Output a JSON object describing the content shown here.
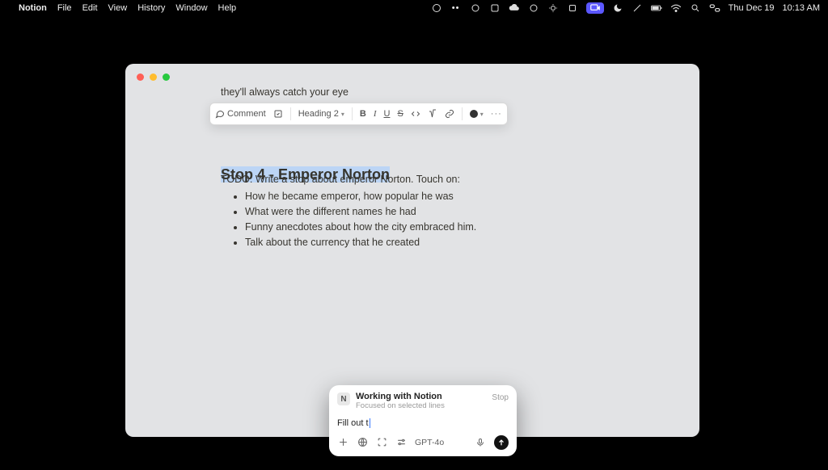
{
  "menubar": {
    "app_name": "Notion",
    "items": [
      "File",
      "Edit",
      "View",
      "History",
      "Window",
      "Help"
    ],
    "date": "Thu Dec 19",
    "time": "10:13 AM"
  },
  "doc": {
    "preceding_line": "they'll always catch your eye",
    "heading": "Stop 4 - Emperor Norton",
    "todo_line": "TODO: Write a stop about emperor Norton. Touch on:",
    "bullets": [
      "How he became emperor, how popular he was",
      "What were the different names he had",
      "Funny anecdotes about how the city embraced him.",
      "Talk about the currency that he created"
    ]
  },
  "toolbar": {
    "comment": "Comment",
    "block_type": "Heading 2",
    "bold": "B",
    "italic": "I",
    "underline": "U",
    "strike": "S"
  },
  "assistant": {
    "title": "Working with Notion",
    "subtitle": "Focused on selected lines",
    "stop": "Stop",
    "input_text": "Fill out t",
    "model": "GPT-4o"
  }
}
